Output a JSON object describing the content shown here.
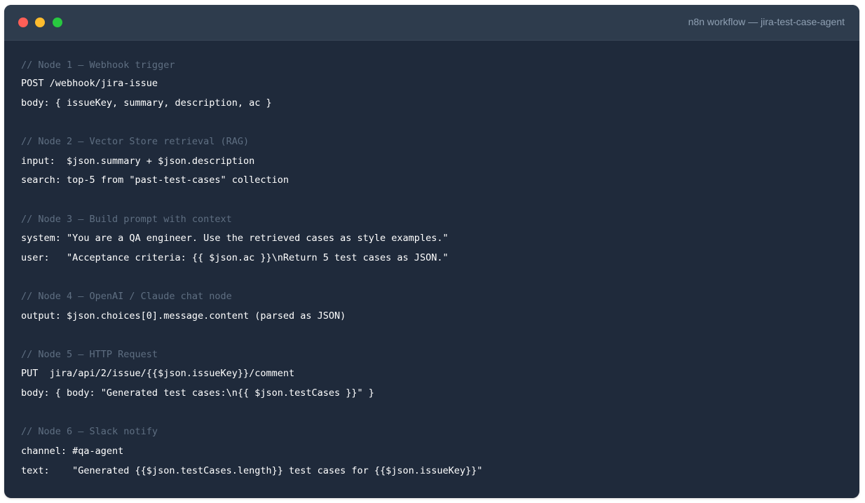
{
  "window": {
    "title": "n8n workflow — jira-test-case-agent",
    "controls": [
      "close",
      "minimize",
      "maximize"
    ]
  },
  "colors": {
    "window_bg": "#1f2a3b",
    "titlebar_bg": "#2e3c4d",
    "close": "#ff5f57",
    "minimize": "#febc2e",
    "maximize": "#28c840",
    "comment": "#5f6f82",
    "code_text": "#ffffff"
  },
  "code": {
    "lines": [
      {
        "kind": "comment",
        "text": "// Node 1 — Webhook trigger"
      },
      {
        "kind": "code",
        "text": "POST /webhook/jira-issue"
      },
      {
        "kind": "code",
        "text": "body: { issueKey, summary, description, ac }"
      },
      {
        "kind": "comment",
        "text": "// Node 2 — Vector Store retrieval (RAG)"
      },
      {
        "kind": "code",
        "text": "input:  $json.summary + $json.description"
      },
      {
        "kind": "code",
        "text": "search: top-5 from \"past-test-cases\" collection"
      },
      {
        "kind": "comment",
        "text": "// Node 3 — Build prompt with context"
      },
      {
        "kind": "code",
        "text": "system: \"You are a QA engineer. Use the retrieved cases as style examples.\""
      },
      {
        "kind": "code",
        "text": "user:   \"Acceptance criteria: {{ $json.ac }}\\nReturn 5 test cases as JSON.\""
      },
      {
        "kind": "comment",
        "text": "// Node 4 — OpenAI / Claude chat node"
      },
      {
        "kind": "code",
        "text": "output: $json.choices[0].message.content (parsed as JSON)"
      },
      {
        "kind": "comment",
        "text": "// Node 5 — HTTP Request"
      },
      {
        "kind": "code",
        "text": "PUT  jira/api/2/issue/{{$json.issueKey}}/comment"
      },
      {
        "kind": "code",
        "text": "body: { body: \"Generated test cases:\\n{{ $json.testCases }}\" }"
      },
      {
        "kind": "comment",
        "text": "// Node 6 — Slack notify"
      },
      {
        "kind": "code",
        "text": "channel: #qa-agent"
      },
      {
        "kind": "code",
        "text": "text:    \"Generated {{$json.testCases.length}} test cases for {{$json.issueKey}}\""
      }
    ]
  }
}
